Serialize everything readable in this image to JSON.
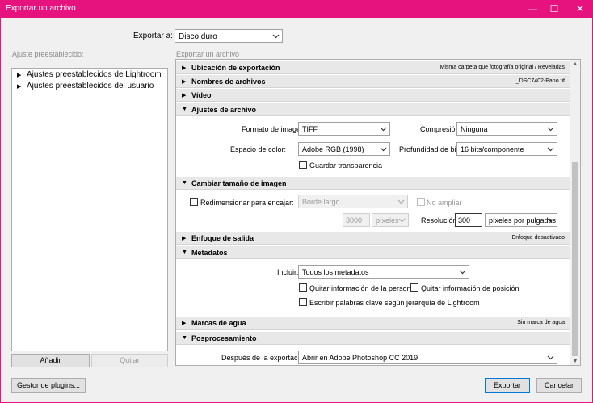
{
  "window": {
    "title": "Exportar un archivo",
    "minimize": "—",
    "maximize": "☐",
    "close": "✕"
  },
  "export_to": {
    "label": "Exportar a:",
    "value": "Disco duro"
  },
  "presets": {
    "header": "Ajuste preestablecido:",
    "items": [
      {
        "label": "Ajustes preestablecidos de Lightroom",
        "expand_icon": "▶"
      },
      {
        "label": "Ajustes preestablecidos del usuario",
        "expand_icon": "▶"
      }
    ],
    "add_button": "Añadir",
    "remove_button": "Quitar"
  },
  "export_panel": {
    "header": "Exportar un archivo",
    "sections": [
      {
        "title": "Ubicación de exportación",
        "summary": "Misma carpeta que fotografía original / Reveladas",
        "icon": "▶"
      },
      {
        "title": "Nombres de archivos",
        "summary": "_DSC7402-Pano.tif",
        "icon": "▶"
      },
      {
        "title": "Vídeo",
        "summary": "",
        "icon": "▶"
      },
      {
        "title": "Ajustes de archivo",
        "summary": "",
        "icon": "▼"
      },
      {
        "title": "Cambiar tamaño de imagen",
        "summary": "",
        "icon": "▼"
      },
      {
        "title": "Enfoque de salida",
        "summary": "Enfoque desactivado",
        "icon": "▶"
      },
      {
        "title": "Metadatos",
        "summary": "",
        "icon": "▼"
      },
      {
        "title": "Marcas de agua",
        "summary": "Sin marca de agua",
        "icon": "▶"
      },
      {
        "title": "Posprocesamiento",
        "summary": "",
        "icon": "▼"
      }
    ],
    "file_settings": {
      "format_label": "Formato de imagen:",
      "format_value": "TIFF",
      "compression_label": "Compresión:",
      "compression_value": "Ninguna",
      "colorspace_label": "Espacio de color:",
      "colorspace_value": "Adobe RGB (1998)",
      "bitdepth_label": "Profundidad de bits:",
      "bitdepth_value": "16 bits/componente",
      "transparency_label": "Guardar transparencia"
    },
    "resize": {
      "fit_label": "Redimensionar para encajar:",
      "fit_value": "Borde largo",
      "no_enlarge_label": "No ampliar",
      "size_value": "3000",
      "unit_value": "píxeles",
      "resolution_label": "Resolución:",
      "resolution_value": "300",
      "resolution_unit": "píxeles por pulgadas"
    },
    "metadata": {
      "include_label": "Incluir:",
      "include_value": "Todos los metadatos",
      "remove_person_label": "Quitar información de la persona",
      "remove_location_label": "Quitar información de posición",
      "hierarchy_label": "Escribir palabras clave según jerarquía de Lightroom"
    },
    "post": {
      "after_label": "Después de la exportación:",
      "after_value": "Abrir en Adobe Photoshop CC 2019"
    }
  },
  "footer": {
    "plugin_button": "Gestor de plugins...",
    "export_button": "Exportar",
    "cancel_button": "Cancelar"
  }
}
